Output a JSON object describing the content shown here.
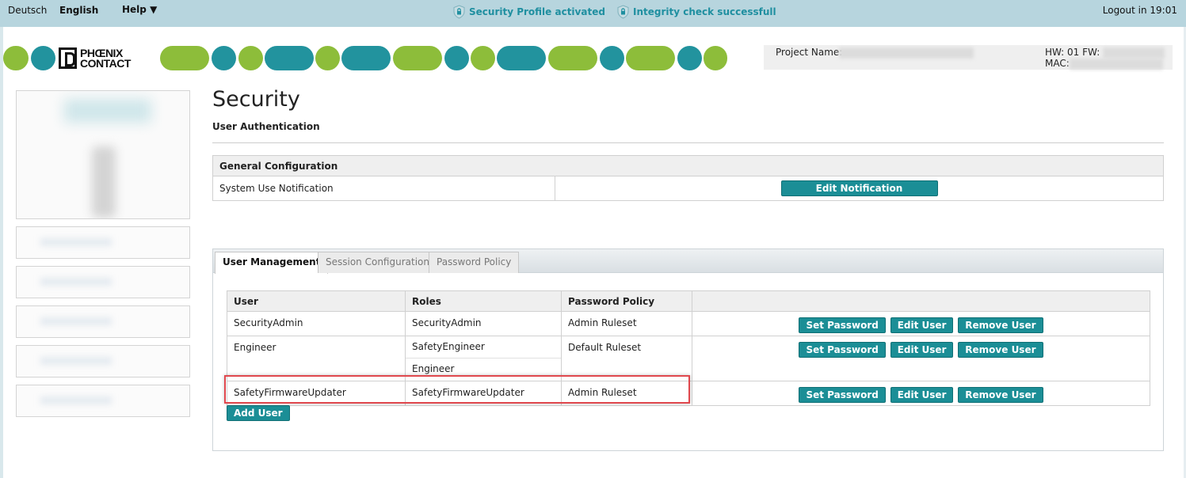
{
  "topbar": {
    "lang_de": "Deutsch",
    "lang_en": "English",
    "help": "Help ▼",
    "status_security": "Security Profile activated",
    "status_integrity": "Integrity check successfull",
    "logout": "Logout in 19:01"
  },
  "brand": {
    "logo_line1": "PHŒNIX",
    "logo_line2": "CONTACT",
    "green": "#8dbd3a",
    "teal": "#22939e"
  },
  "device": {
    "project_label": "Project Name:",
    "hw_label": "HW: 01 FW:",
    "mac_label": "MAC:"
  },
  "page": {
    "title": "Security",
    "subtitle": "User Authentication"
  },
  "general": {
    "header": "General Configuration",
    "row_label": "System Use Notification",
    "button": "Edit Notification"
  },
  "tabs": [
    {
      "label": "User Management",
      "active": true
    },
    {
      "label": "Session Configuration",
      "active": false
    },
    {
      "label": "Password Policy",
      "active": false
    }
  ],
  "users": {
    "headers": [
      "User",
      "Roles",
      "Password Policy"
    ],
    "rows": [
      {
        "user": "SecurityAdmin",
        "roles": [
          "SecurityAdmin"
        ],
        "policy": "Admin Ruleset"
      },
      {
        "user": "Engineer",
        "roles": [
          "SafetyEngineer",
          "Engineer"
        ],
        "policy": "Default Ruleset"
      },
      {
        "user": "SafetyFirmwareUpdater",
        "roles": [
          "SafetyFirmwareUpdater"
        ],
        "policy": "Admin Ruleset"
      }
    ],
    "btn_set_password": "Set Password",
    "btn_edit_user": "Edit User",
    "btn_remove_user": "Remove User",
    "btn_add_user": "Add User"
  },
  "colors": {
    "accent": "#1b8e96",
    "highlight": "#e0484e"
  }
}
